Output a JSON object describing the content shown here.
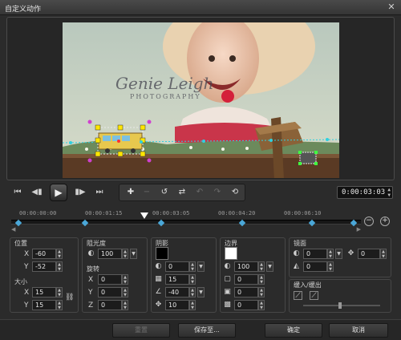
{
  "window": {
    "title": "自定义动作",
    "close_icon": "close-icon"
  },
  "preview": {
    "watermark_line1": "Genie Leigh",
    "watermark_line2": "PHOTOGRAPHY"
  },
  "transport": {
    "timecode": "0:00:03:03",
    "icons": [
      "skip-start-icon",
      "step-back-icon",
      "play-icon",
      "step-forward-icon",
      "skip-end-icon"
    ],
    "tool_icons": [
      "add-keyframe-icon",
      "remove-keyframe-icon",
      "reverse-keyframe-icon",
      "swap-icon",
      "undo-icon",
      "redo-icon",
      "reset-icon"
    ]
  },
  "timeline": {
    "ruler": [
      "00:00:00:00",
      "00:00:01:15",
      "00:00:03:05",
      "00:00:04:20",
      "00:00:06:10"
    ],
    "keyframes": [
      0.02,
      0.21,
      0.43,
      0.66,
      0.86,
      0.98
    ],
    "playhead_fraction": 0.38
  },
  "position": {
    "label": "位置",
    "x_label": "X",
    "x_value": "-60",
    "y_label": "Y",
    "y_value": "-52"
  },
  "size": {
    "label": "大小",
    "x_label": "X",
    "x_value": "15",
    "y_label": "Y",
    "y_value": "15"
  },
  "opacity": {
    "label": "阻光度",
    "value": "100"
  },
  "rotation": {
    "label": "旋转",
    "x_label": "X",
    "x_value": "0",
    "y_label": "Y",
    "y_value": "0",
    "z_label": "Z",
    "z_value": "0"
  },
  "shadow": {
    "label": "阴影",
    "color": "#000000",
    "opacity": "0",
    "blur": "15",
    "angle": "-40",
    "distance": "10"
  },
  "border": {
    "label": "边界",
    "color": "#ffffff",
    "opacity": "100",
    "v1": "0",
    "v2": "0",
    "v3": "0"
  },
  "mirror": {
    "label": "镜面",
    "v1": "0",
    "v2": "0",
    "v3": "0"
  },
  "ease": {
    "label": "缓入/缓出"
  },
  "buttons": {
    "reset": "重置",
    "save_to": "保存至...",
    "ok": "确定",
    "cancel": "取消"
  },
  "colors": {
    "accent": "#4aa7d8",
    "bg": "#2b2b2b"
  }
}
